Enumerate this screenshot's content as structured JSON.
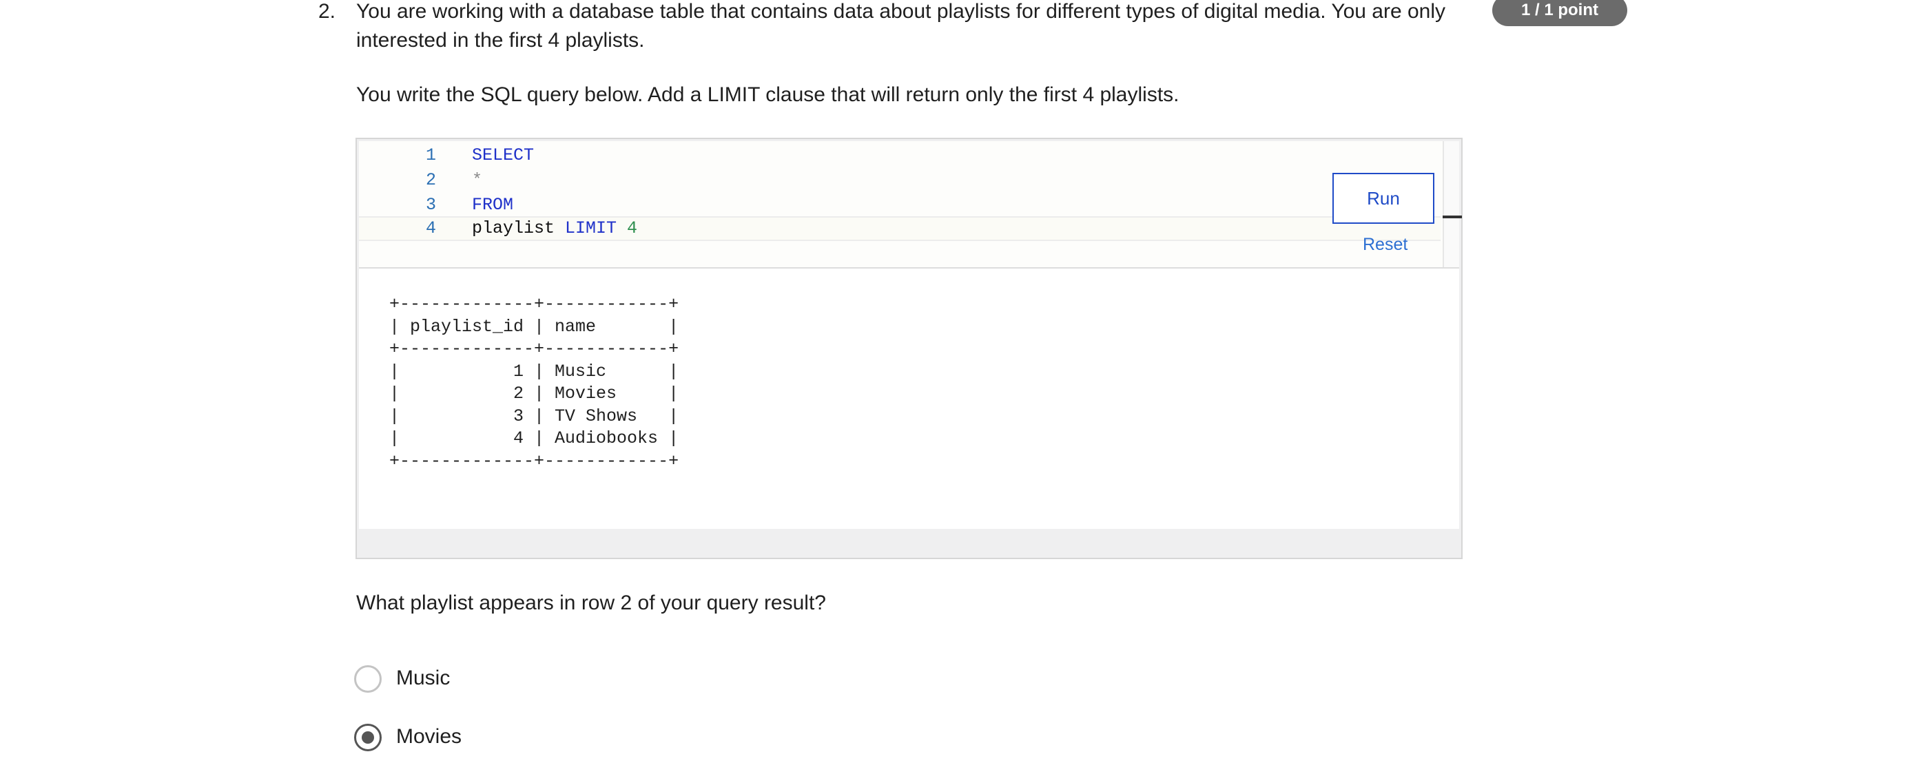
{
  "question": {
    "number": "2.",
    "prompt_line1": "You are working with a database table that contains data about playlists for different types of digital media. You are only",
    "prompt_line2": "interested in the first 4 playlists.",
    "instruction": "You write the SQL query below. Add a LIMIT clause that will return only the first 4 playlists.",
    "points": "1 / 1 point",
    "followup": "What playlist appears in row 2 of your query result?"
  },
  "editor": {
    "lines": [
      {
        "number": "1",
        "tokens": [
          "SELECT"
        ]
      },
      {
        "number": "2",
        "tokens": [
          "*"
        ]
      },
      {
        "number": "3",
        "tokens": [
          "FROM"
        ]
      },
      {
        "number": "4",
        "tokens": [
          "playlist",
          " LIMIT",
          " 4"
        ]
      }
    ],
    "run_label": "Run",
    "reset_label": "Reset"
  },
  "output": {
    "lines": [
      "+-------------+------------+",
      "| playlist_id | name       |",
      "+-------------+------------+",
      "|           1 | Music      |",
      "|           2 | Movies     |",
      "|           3 | TV Shows   |",
      "|           4 | Audiobooks |",
      "+-------------+------------+"
    ]
  },
  "options": [
    {
      "label": "Music",
      "selected": false
    },
    {
      "label": "Movies",
      "selected": true
    }
  ]
}
